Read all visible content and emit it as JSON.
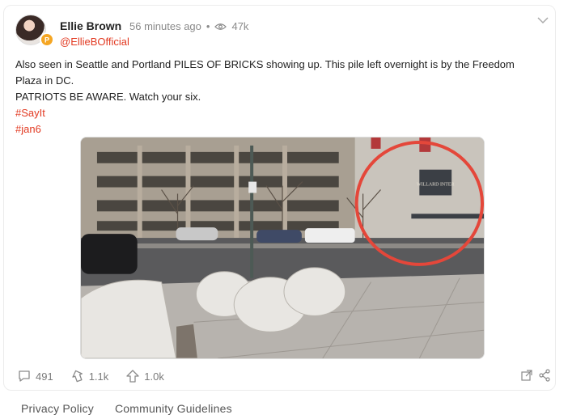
{
  "post": {
    "author_name": "Ellie Brown",
    "timestamp": "56 minutes ago",
    "separator": "•",
    "views": "47k",
    "handle": "@EllieBOfficial",
    "text_lines": [
      "Also seen in Seattle and Portland PILES OF BRICKS showing up. This pile left overnight is by the Freedom Plaza in DC.",
      "PATRIOTS BE AWARE. Watch your six."
    ],
    "hashtags": [
      "#SayIt",
      "#jan6"
    ],
    "image_alt": "Street corner with bags of bricks on the sidewalk; a building circled in red",
    "building_sign": "WILLARD INTER"
  },
  "actions": {
    "comments": "491",
    "reposts": "1.1k",
    "upvotes": "1.0k"
  },
  "footer": {
    "privacy": "Privacy Policy",
    "guidelines": "Community Guidelines"
  },
  "colors": {
    "accent": "#e23a22",
    "badge": "#f5a623",
    "muted": "#8a8a8a"
  }
}
